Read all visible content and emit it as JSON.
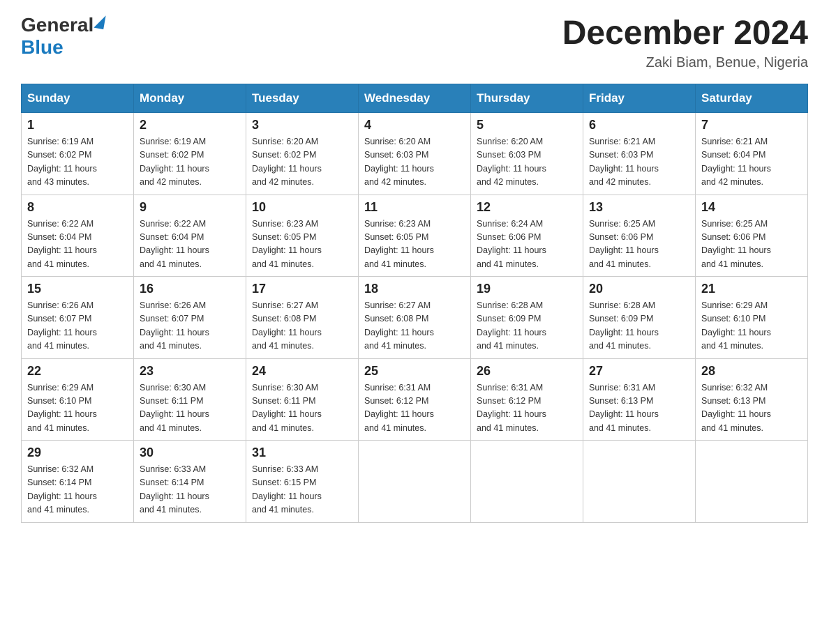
{
  "header": {
    "logo_general": "General",
    "logo_blue": "Blue",
    "month_year": "December 2024",
    "location": "Zaki Biam, Benue, Nigeria"
  },
  "days_of_week": [
    "Sunday",
    "Monday",
    "Tuesday",
    "Wednesday",
    "Thursday",
    "Friday",
    "Saturday"
  ],
  "weeks": [
    [
      {
        "day": "1",
        "sunrise": "6:19 AM",
        "sunset": "6:02 PM",
        "daylight": "11 hours and 43 minutes."
      },
      {
        "day": "2",
        "sunrise": "6:19 AM",
        "sunset": "6:02 PM",
        "daylight": "11 hours and 42 minutes."
      },
      {
        "day": "3",
        "sunrise": "6:20 AM",
        "sunset": "6:02 PM",
        "daylight": "11 hours and 42 minutes."
      },
      {
        "day": "4",
        "sunrise": "6:20 AM",
        "sunset": "6:03 PM",
        "daylight": "11 hours and 42 minutes."
      },
      {
        "day": "5",
        "sunrise": "6:20 AM",
        "sunset": "6:03 PM",
        "daylight": "11 hours and 42 minutes."
      },
      {
        "day": "6",
        "sunrise": "6:21 AM",
        "sunset": "6:03 PM",
        "daylight": "11 hours and 42 minutes."
      },
      {
        "day": "7",
        "sunrise": "6:21 AM",
        "sunset": "6:04 PM",
        "daylight": "11 hours and 42 minutes."
      }
    ],
    [
      {
        "day": "8",
        "sunrise": "6:22 AM",
        "sunset": "6:04 PM",
        "daylight": "11 hours and 41 minutes."
      },
      {
        "day": "9",
        "sunrise": "6:22 AM",
        "sunset": "6:04 PM",
        "daylight": "11 hours and 41 minutes."
      },
      {
        "day": "10",
        "sunrise": "6:23 AM",
        "sunset": "6:05 PM",
        "daylight": "11 hours and 41 minutes."
      },
      {
        "day": "11",
        "sunrise": "6:23 AM",
        "sunset": "6:05 PM",
        "daylight": "11 hours and 41 minutes."
      },
      {
        "day": "12",
        "sunrise": "6:24 AM",
        "sunset": "6:06 PM",
        "daylight": "11 hours and 41 minutes."
      },
      {
        "day": "13",
        "sunrise": "6:25 AM",
        "sunset": "6:06 PM",
        "daylight": "11 hours and 41 minutes."
      },
      {
        "day": "14",
        "sunrise": "6:25 AM",
        "sunset": "6:06 PM",
        "daylight": "11 hours and 41 minutes."
      }
    ],
    [
      {
        "day": "15",
        "sunrise": "6:26 AM",
        "sunset": "6:07 PM",
        "daylight": "11 hours and 41 minutes."
      },
      {
        "day": "16",
        "sunrise": "6:26 AM",
        "sunset": "6:07 PM",
        "daylight": "11 hours and 41 minutes."
      },
      {
        "day": "17",
        "sunrise": "6:27 AM",
        "sunset": "6:08 PM",
        "daylight": "11 hours and 41 minutes."
      },
      {
        "day": "18",
        "sunrise": "6:27 AM",
        "sunset": "6:08 PM",
        "daylight": "11 hours and 41 minutes."
      },
      {
        "day": "19",
        "sunrise": "6:28 AM",
        "sunset": "6:09 PM",
        "daylight": "11 hours and 41 minutes."
      },
      {
        "day": "20",
        "sunrise": "6:28 AM",
        "sunset": "6:09 PM",
        "daylight": "11 hours and 41 minutes."
      },
      {
        "day": "21",
        "sunrise": "6:29 AM",
        "sunset": "6:10 PM",
        "daylight": "11 hours and 41 minutes."
      }
    ],
    [
      {
        "day": "22",
        "sunrise": "6:29 AM",
        "sunset": "6:10 PM",
        "daylight": "11 hours and 41 minutes."
      },
      {
        "day": "23",
        "sunrise": "6:30 AM",
        "sunset": "6:11 PM",
        "daylight": "11 hours and 41 minutes."
      },
      {
        "day": "24",
        "sunrise": "6:30 AM",
        "sunset": "6:11 PM",
        "daylight": "11 hours and 41 minutes."
      },
      {
        "day": "25",
        "sunrise": "6:31 AM",
        "sunset": "6:12 PM",
        "daylight": "11 hours and 41 minutes."
      },
      {
        "day": "26",
        "sunrise": "6:31 AM",
        "sunset": "6:12 PM",
        "daylight": "11 hours and 41 minutes."
      },
      {
        "day": "27",
        "sunrise": "6:31 AM",
        "sunset": "6:13 PM",
        "daylight": "11 hours and 41 minutes."
      },
      {
        "day": "28",
        "sunrise": "6:32 AM",
        "sunset": "6:13 PM",
        "daylight": "11 hours and 41 minutes."
      }
    ],
    [
      {
        "day": "29",
        "sunrise": "6:32 AM",
        "sunset": "6:14 PM",
        "daylight": "11 hours and 41 minutes."
      },
      {
        "day": "30",
        "sunrise": "6:33 AM",
        "sunset": "6:14 PM",
        "daylight": "11 hours and 41 minutes."
      },
      {
        "day": "31",
        "sunrise": "6:33 AM",
        "sunset": "6:15 PM",
        "daylight": "11 hours and 41 minutes."
      },
      null,
      null,
      null,
      null
    ]
  ],
  "labels": {
    "sunrise": "Sunrise:",
    "sunset": "Sunset:",
    "daylight": "Daylight:"
  }
}
